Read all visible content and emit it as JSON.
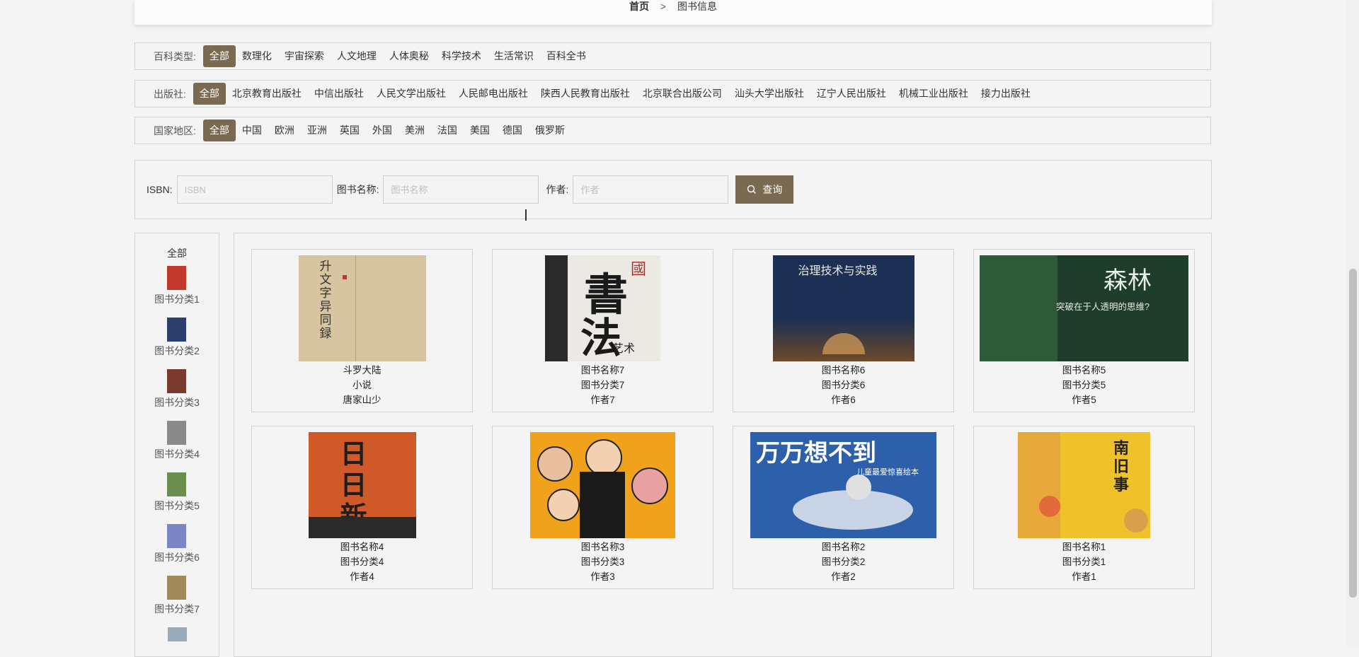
{
  "breadcrumb": {
    "home": "首页",
    "separator": ">",
    "current": "图书信息"
  },
  "filters": [
    {
      "label": "百科类型:",
      "options": [
        "全部",
        "数理化",
        "宇宙探索",
        "人文地理",
        "人体奥秘",
        "科学技术",
        "生活常识",
        "百科全书"
      ],
      "active": 0
    },
    {
      "label": "出版社:",
      "options": [
        "全部",
        "北京教育出版社",
        "中信出版社",
        "人民文学出版社",
        "人民邮电出版社",
        "陕西人民教育出版社",
        "北京联合出版公司",
        "汕头大学出版社",
        "辽宁人民出版社",
        "机械工业出版社",
        "接力出版社"
      ],
      "active": 0
    },
    {
      "label": "国家地区:",
      "options": [
        "全部",
        "中国",
        "欧洲",
        "亚洲",
        "英国",
        "外国",
        "美洲",
        "法国",
        "美国",
        "德国",
        "俄罗斯"
      ],
      "active": 0
    }
  ],
  "search": {
    "isbn_label": "ISBN:",
    "isbn_placeholder": "ISBN",
    "name_label": "图书名称:",
    "name_placeholder": "图书名称",
    "author_label": "作者:",
    "author_placeholder": "作者",
    "button_label": "查询"
  },
  "sidebar": {
    "all_label": "全部",
    "items": [
      {
        "label": "图书分类1",
        "color": "#c0392b"
      },
      {
        "label": "图书分类2",
        "color": "#2c3e6b"
      },
      {
        "label": "图书分类3",
        "color": "#7a3b2e"
      },
      {
        "label": "图书分类4",
        "color": "#8a8a8a"
      },
      {
        "label": "图书分类5",
        "color": "#6b8e4e"
      },
      {
        "label": "图书分类6",
        "color": "#7d86c4"
      },
      {
        "label": "图书分类7",
        "color": "#a08a5a"
      }
    ]
  },
  "books": [
    {
      "name": "斗罗大陆",
      "category": "小说",
      "author": "唐家山少",
      "cover": "calligraphy-beige"
    },
    {
      "name": "图书名称7",
      "category": "图书分类7",
      "author": "作者7",
      "cover": "shufa-black-white"
    },
    {
      "name": "图书名称6",
      "category": "图书分类6",
      "author": "作者6",
      "cover": "navy-night"
    },
    {
      "name": "图书名称5",
      "category": "图书分类5",
      "author": "作者5",
      "cover": "green-forest"
    },
    {
      "name": "图书名称4",
      "category": "图书分类4",
      "author": "作者4",
      "cover": "orange-ri-ri-xin"
    },
    {
      "name": "图书名称3",
      "category": "图书分类3",
      "author": "作者3",
      "cover": "comic-yellow"
    },
    {
      "name": "图书名称2",
      "category": "图书分类2",
      "author": "作者2",
      "cover": "blue-whale"
    },
    {
      "name": "图书名称1",
      "category": "图书分类1",
      "author": "作者1",
      "cover": "yellow-floral"
    }
  ],
  "cover_text": {
    "c1": "升文字异同録",
    "c2a": "書",
    "c2b": "法",
    "c2c": "國",
    "c2d": "艺术",
    "c3": "治理技术与实践",
    "c4a": "森林",
    "c4b": "突破在于人透明的思维?",
    "c5": "日日新",
    "c7a": "万万想不到",
    "c7b": "儿童最爱惊喜绘本",
    "c8": "南旧事"
  },
  "colors": {
    "accent": "#7b6a52",
    "border": "#d3d3d3",
    "background": "#f4f4f4"
  }
}
